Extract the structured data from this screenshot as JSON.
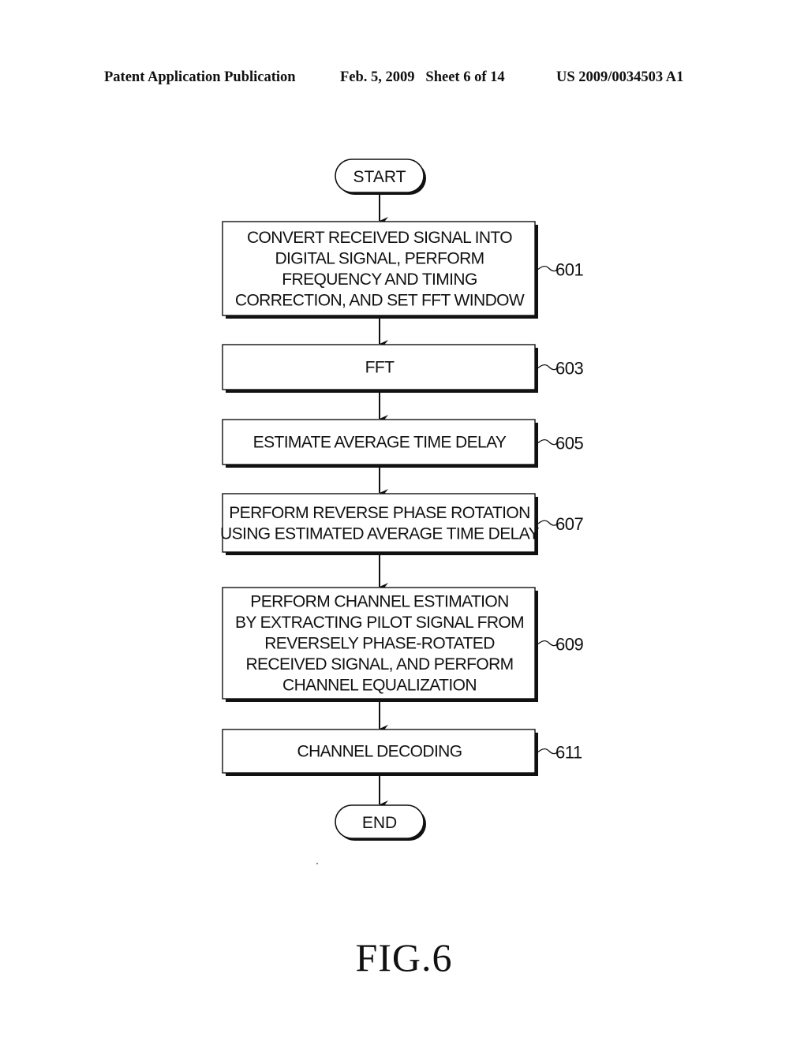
{
  "header": {
    "publication": "Patent Application Publication",
    "date_sheet": "Feb. 5, 2009   Sheet 6 of 14",
    "patent_number": "US 2009/0034503 A1"
  },
  "flowchart": {
    "start_label": "START",
    "end_label": "END",
    "steps": [
      {
        "ref": "601",
        "lines": [
          "CONVERT RECEIVED SIGNAL INTO",
          "DIGITAL SIGNAL, PERFORM",
          "FREQUENCY AND TIMING",
          "CORRECTION, AND SET FFT WINDOW"
        ]
      },
      {
        "ref": "603",
        "lines": [
          "FFT"
        ]
      },
      {
        "ref": "605",
        "lines": [
          "ESTIMATE AVERAGE TIME DELAY"
        ]
      },
      {
        "ref": "607",
        "lines": [
          "PERFORM REVERSE PHASE ROTATION",
          "USING ESTIMATED AVERAGE TIME DELAY"
        ]
      },
      {
        "ref": "609",
        "lines": [
          "PERFORM CHANNEL ESTIMATION",
          "BY EXTRACTING PILOT SIGNAL FROM",
          "REVERSELY PHASE-ROTATED",
          "RECEIVED SIGNAL, AND PERFORM",
          "CHANNEL EQUALIZATION"
        ]
      },
      {
        "ref": "611",
        "lines": [
          "CHANNEL DECODING"
        ]
      }
    ]
  },
  "figure_label": "FIG.6"
}
